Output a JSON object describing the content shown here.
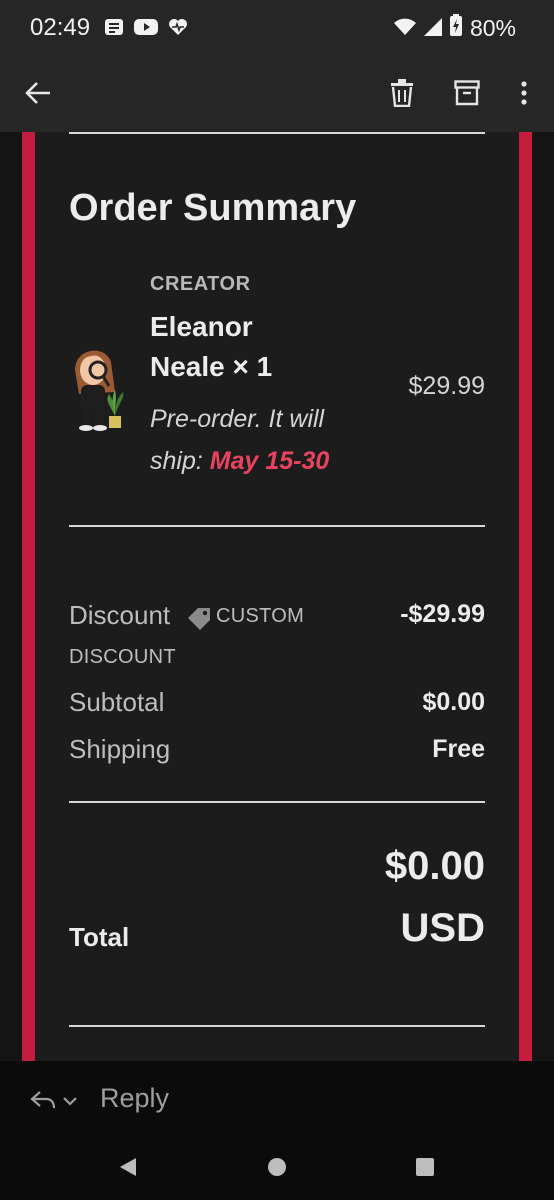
{
  "status_bar": {
    "time": "02:49",
    "battery": "80%",
    "icons": [
      "notes-icon",
      "youtube-icon",
      "heart-pulse-icon",
      "wifi-icon",
      "signal-icon",
      "battery-icon"
    ]
  },
  "toolbar": {
    "icons": [
      "back-arrow-icon",
      "delete-icon",
      "archive-icon",
      "more-vert-icon"
    ]
  },
  "order": {
    "title": "Order Summary",
    "creator_label": "CREATOR",
    "item_name": "Eleanor Neale × 1",
    "item_price": "$29.99",
    "preorder_text": "Pre-order. It will ship: ",
    "ship_date": "May 15-30",
    "discount_label": "Discount",
    "discount_code_line1": "CUSTOM",
    "discount_code_line2": "DISCOUNT",
    "discount_value": "-$29.99",
    "subtotal_label": "Subtotal",
    "subtotal_value": "$0.00",
    "shipping_label": "Shipping",
    "shipping_value": "Free",
    "total_label": "Total",
    "total_amount": "$0.00",
    "total_currency": "USD"
  },
  "reply": {
    "label": "Reply"
  },
  "colors": {
    "accent_border": "#c51d3f",
    "ship_date": "#e8435f",
    "background": "#1c1c1c"
  }
}
